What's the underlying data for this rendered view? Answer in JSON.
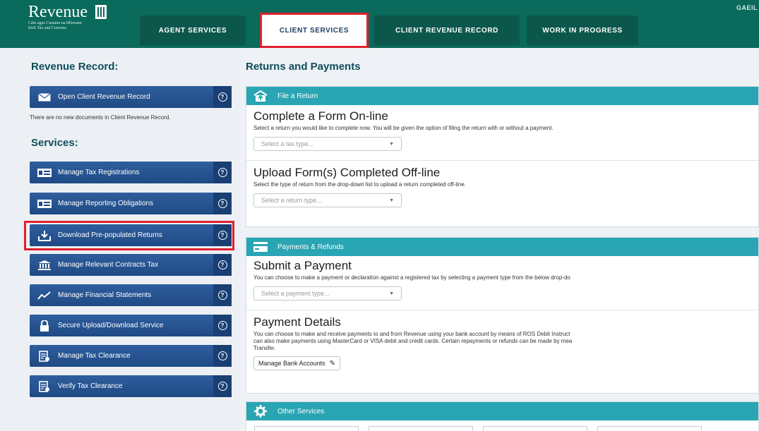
{
  "header": {
    "logo_word": "Revenue",
    "logo_sub1": "Cáin agus Custaim na hÉireann",
    "logo_sub2": "Irish Tax and Customs",
    "gaeilge": "GAEIL",
    "tabs": [
      "AGENT SERVICES",
      "CLIENT SERVICES",
      "CLIENT REVENUE RECORD",
      "WORK IN PROGRESS"
    ]
  },
  "left": {
    "revenue_record_title": "Revenue Record:",
    "open_record": "Open Client Revenue Record",
    "no_docs": "There are no new documents in Client Revenue Record.",
    "services_title": "Services:",
    "services": [
      "Manage Tax Registrations",
      "Manage Reporting Obligations",
      "Download Pre-populated Returns",
      "Manage Relevant Contracts Tax",
      "Manage Financial Statements",
      "Secure Upload/Download Service",
      "Manage Tax Clearance",
      "Verify Tax Clearance"
    ],
    "help": "?"
  },
  "main": {
    "title": "Returns and Payments",
    "file_return": {
      "header": "File a Return",
      "complete_title": "Complete a Form On-line",
      "complete_desc": "Select a return you would like to complete now. You will be given the option of filing the return with or without a payment.",
      "complete_placeholder": "Select a tax type...",
      "upload_title": "Upload Form(s) Completed Off-line",
      "upload_desc": "Select the type of return from the drop-down list to upload a return completed off-line.",
      "upload_placeholder": "Select a return type..."
    },
    "payments": {
      "header": "Payments & Refunds",
      "submit_title": "Submit a Payment",
      "submit_desc": "You can choose to make a payment or declaration against a registered tax by selecting a payment type from the below drop-do",
      "submit_placeholder": "Select a payment type...",
      "details_title": "Payment Details",
      "details_desc1": "You can choose to make and receive payments to and from Revenue using your bank account by means of ROS Debit Instruct",
      "details_desc2": "can also make payments using MasterCard or VISA debit and credit cards. Certain repayments or refunds can be made by mea",
      "details_desc3": "Transfer.",
      "manage_bank": "Manage Bank Accounts"
    },
    "other": {
      "header": "Other Services"
    }
  }
}
